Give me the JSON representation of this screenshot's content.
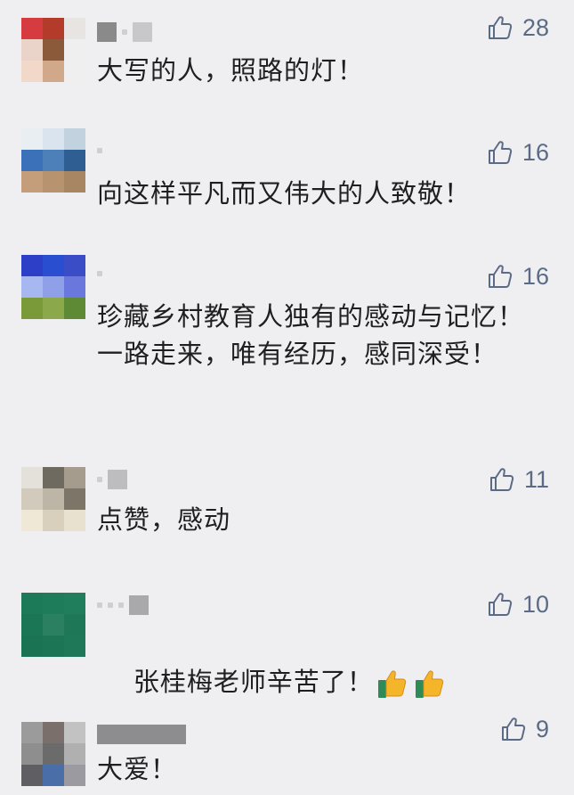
{
  "comments": [
    {
      "text": "大写的人，照路的灯！",
      "likes": "28",
      "avatar_colors": [
        "#d63b3f",
        "#b43a2a",
        "#e7e4e2",
        "#ead3c9",
        "#8a5a3b",
        "#f0efef",
        "#f1d8c9",
        "#d2a88a",
        "#efefef"
      ]
    },
    {
      "text": "向这样平凡而又伟大的人致敬！",
      "likes": "16",
      "avatar_colors": [
        "#e9eef3",
        "#d9e4ee",
        "#c2d2df",
        "#3a71b8",
        "#4d7fb8",
        "#2f5e93",
        "#c49d7b",
        "#b7936f",
        "#a88563"
      ]
    },
    {
      "text": "珍藏乡村教育人独有的感动与记忆！一路走来，唯有经历，感同深受！",
      "likes": "16",
      "avatar_colors": [
        "#2d3fc7",
        "#2a4ed0",
        "#3b4dc6",
        "#a7b7f0",
        "#8f9fe8",
        "#6a78de",
        "#7a9a3a",
        "#8ba84a",
        "#5e8a36"
      ]
    },
    {
      "text": "点赞，感动",
      "likes": "11",
      "avatar_colors": [
        "#e4e1da",
        "#6e6a5f",
        "#a59c8d",
        "#d1cabd",
        "#bdb5a6",
        "#7d7567",
        "#efe8d6",
        "#d8cfbd",
        "#e9e1cf"
      ]
    },
    {
      "text": "张桂梅老师辛苦了！",
      "likes": "10",
      "emoji_count": 2,
      "avatar_colors": [
        "#1d7a58",
        "#1f7c5a",
        "#217e5c",
        "#1b7656",
        "#2a8060",
        "#1e7858",
        "#1a7454",
        "#1c7656",
        "#1f7959"
      ]
    },
    {
      "text": "大爱！",
      "likes": "9",
      "avatar_colors": [
        "#9b9b9b",
        "#7a6f6a",
        "#c2c2c2",
        "#8e8e8e",
        "#6b6b6b",
        "#b0b0b0",
        "#5e5e63",
        "#4a6fa8",
        "#9a9aa0"
      ]
    }
  ]
}
